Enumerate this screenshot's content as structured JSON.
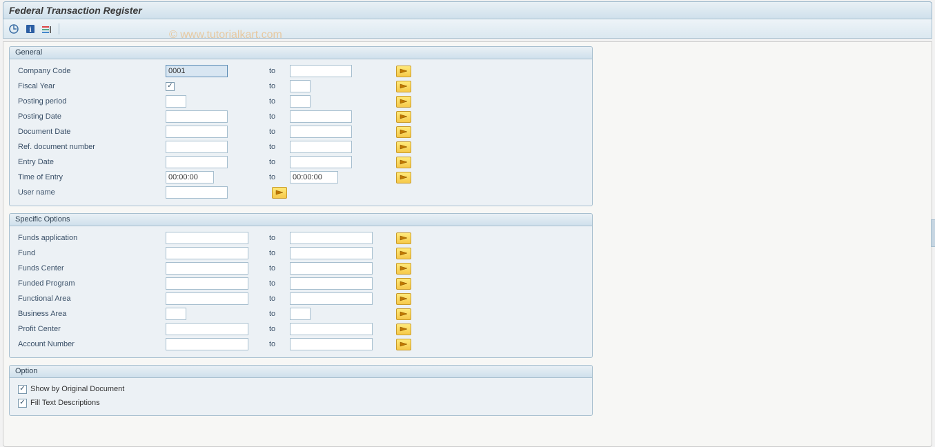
{
  "title": "Federal Transaction Register",
  "watermark": "© www.tutorialkart.com",
  "groups": {
    "general": {
      "title": "General",
      "rows": {
        "company_code": {
          "label": "Company Code",
          "from": "0001",
          "to_label": "to",
          "to": ""
        },
        "fiscal_year": {
          "label": "Fiscal Year",
          "from": "",
          "to_label": "to",
          "to": "",
          "checkbox": true
        },
        "posting_period": {
          "label": "Posting period",
          "from": "",
          "to_label": "to",
          "to": ""
        },
        "posting_date": {
          "label": "Posting Date",
          "from": "",
          "to_label": "to",
          "to": ""
        },
        "document_date": {
          "label": "Document Date",
          "from": "",
          "to_label": "to",
          "to": ""
        },
        "ref_doc": {
          "label": "Ref. document number",
          "from": "",
          "to_label": "to",
          "to": ""
        },
        "entry_date": {
          "label": "Entry Date",
          "from": "",
          "to_label": "to",
          "to": ""
        },
        "time_of_entry": {
          "label": "Time of Entry",
          "from": "00:00:00",
          "to_label": "to",
          "to": "00:00:00"
        },
        "user_name": {
          "label": "User name",
          "from": ""
        }
      }
    },
    "specific": {
      "title": "Specific Options",
      "rows": {
        "funds_app": {
          "label": "Funds application",
          "from": "",
          "to_label": "to",
          "to": ""
        },
        "fund": {
          "label": "Fund",
          "from": "",
          "to_label": "to",
          "to": ""
        },
        "funds_center": {
          "label": "Funds Center",
          "from": "",
          "to_label": "to",
          "to": ""
        },
        "funded_prog": {
          "label": "Funded Program",
          "from": "",
          "to_label": "to",
          "to": ""
        },
        "func_area": {
          "label": "Functional Area",
          "from": "",
          "to_label": "to",
          "to": ""
        },
        "bus_area": {
          "label": "Business Area",
          "from": "",
          "to_label": "to",
          "to": ""
        },
        "profit_center": {
          "label": "Profit Center",
          "from": "",
          "to_label": "to",
          "to": ""
        },
        "account_no": {
          "label": "Account Number",
          "from": "",
          "to_label": "to",
          "to": ""
        }
      }
    },
    "option": {
      "title": "Option",
      "checks": {
        "show_orig": {
          "label": "Show by Original Document",
          "checked": true
        },
        "fill_text": {
          "label": "Fill Text Descriptions",
          "checked": true
        }
      }
    }
  },
  "toolbar": {
    "execute": "Execute",
    "info": "Information",
    "variant": "Get Variant"
  }
}
